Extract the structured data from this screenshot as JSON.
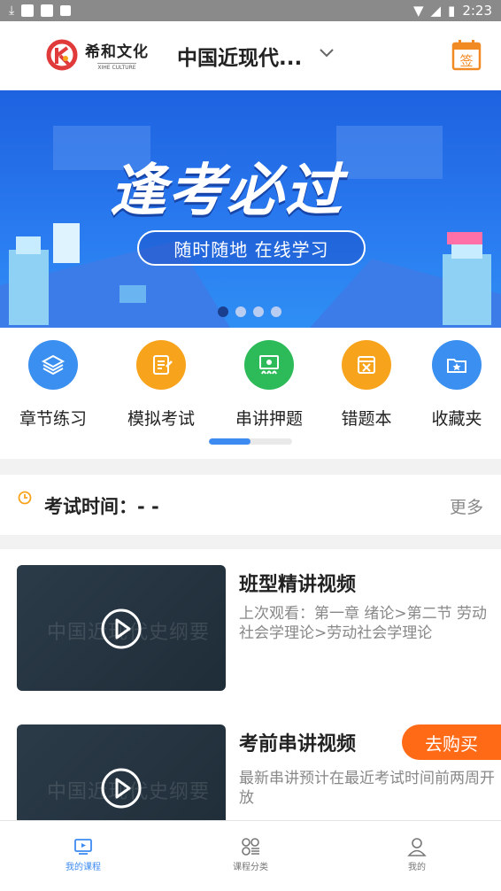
{
  "status_bar": {
    "time": "2:23"
  },
  "header": {
    "logo_cn": "希和文化",
    "logo_en": "XIHE CULTURE",
    "course_title": "中国近现代...",
    "signin_label": "签"
  },
  "banner": {
    "slogan": "逢考必过",
    "subtitle": "随时随地 在线学习",
    "slide_count": 4,
    "active_slide": 1
  },
  "menu": {
    "items": [
      {
        "label": "章节练习",
        "icon": "layers-icon",
        "color": "#3b8ff0"
      },
      {
        "label": "模拟考试",
        "icon": "exam-paper-icon",
        "color": "#f7a31c"
      },
      {
        "label": "串讲押题",
        "icon": "lecture-board-icon",
        "color": "#2dba59"
      },
      {
        "label": "错题本",
        "icon": "wrong-notebook-icon",
        "color": "#f7a31c"
      },
      {
        "label": "收藏夹",
        "icon": "star-folder-icon",
        "color": "#3b8ff0"
      }
    ],
    "scroll_progress": 0.5
  },
  "exam": {
    "label": "考试时间：- -",
    "more": "更多"
  },
  "courses": [
    {
      "title": "班型精讲视频",
      "desc": "上次观看：第一章 绪论>第二节 劳动社会学理论>劳动社会学理论",
      "watermark": "中国近现代史纲要"
    },
    {
      "title": "考前串讲视频",
      "desc": "最新串讲预计在最近考试时间前两周开放",
      "watermark": "中国近现代史纲要",
      "buy_label": "去购买"
    }
  ],
  "tabbar": {
    "items": [
      {
        "label": "我的课程",
        "icon": "video-screen-icon"
      },
      {
        "label": "课程分类",
        "icon": "category-grid-icon"
      },
      {
        "label": "我的",
        "icon": "user-icon"
      }
    ],
    "active": 0
  },
  "colors": {
    "accent": "#3d8bf0",
    "brand_red": "#e03a3a",
    "buy_orange": "#ff6a17",
    "banner_blue": "#1e62e0"
  }
}
